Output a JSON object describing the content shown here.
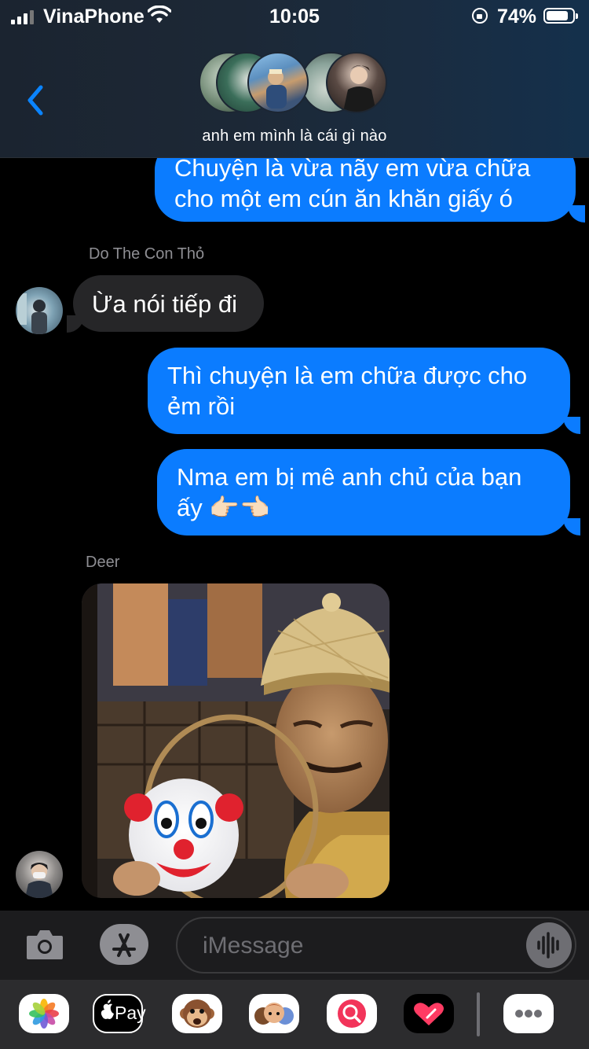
{
  "status_bar": {
    "carrier": "VinaPhone",
    "time": "10:05",
    "battery_percent": "74%",
    "battery_level": 0.74
  },
  "header": {
    "group_name": "anh em mình là cái gì nào"
  },
  "messages": [
    {
      "direction": "outgoing",
      "lines": [
        "Chuyện là vừa nãy em vừa chữa",
        "cho một em cún ăn khăn giấy ó"
      ]
    },
    {
      "direction": "incoming",
      "sender": "Do The Con Thỏ",
      "lines": [
        "Ừa nói tiếp đi"
      ]
    },
    {
      "direction": "outgoing",
      "lines": [
        "Thì chuyện là em chữa được cho",
        "ẻm rồi"
      ]
    },
    {
      "direction": "outgoing",
      "lines": [
        "Nma em bị mê anh chủ của bạn",
        "ấy 👉🏻👈🏻"
      ]
    },
    {
      "direction": "incoming",
      "sender": "Deer",
      "attachment": "meme-image"
    }
  ],
  "input": {
    "placeholder": "iMessage"
  },
  "colors": {
    "outgoing_bubble": "#0b7cff",
    "incoming_bubble": "#262628",
    "accent": "#0a84ff"
  },
  "app_drawer": [
    "photos-app-icon",
    "apple-pay-icon",
    "animoji-icon",
    "memoji-icon",
    "web-images-icon",
    "digital-touch-icon",
    "more-apps-icon"
  ],
  "apple_pay_label": "Pay"
}
